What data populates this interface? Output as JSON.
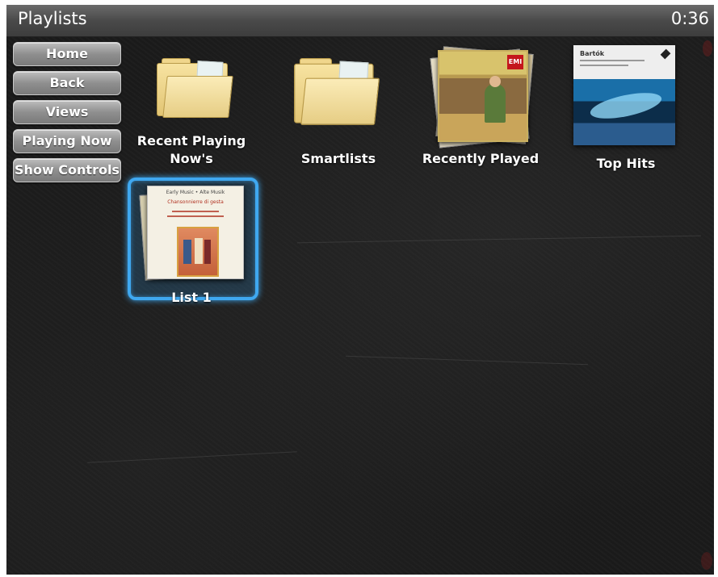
{
  "header": {
    "title": "Playlists",
    "time": "0:36"
  },
  "nav": {
    "home": "Home",
    "back": "Back",
    "views": "Views",
    "playing_now": "Playing Now",
    "show_controls": "Show Controls"
  },
  "tiles": {
    "recent_playing": "Recent Playing\nNow's",
    "smartlists": "Smartlists",
    "recently_played": "Recently Played",
    "top_hits": "Top Hits",
    "list1": "List 1"
  },
  "album_art": {
    "recently_played_badge": "EMI",
    "top_hits_title": "Bartók",
    "list1_header": "Early Music • Alte Musik",
    "list1_title": "Chansonnierre di gesta"
  },
  "colors": {
    "selection": "#3fa8f0",
    "background": "#1b1b1b",
    "titlebar": "#4a4a4a"
  }
}
